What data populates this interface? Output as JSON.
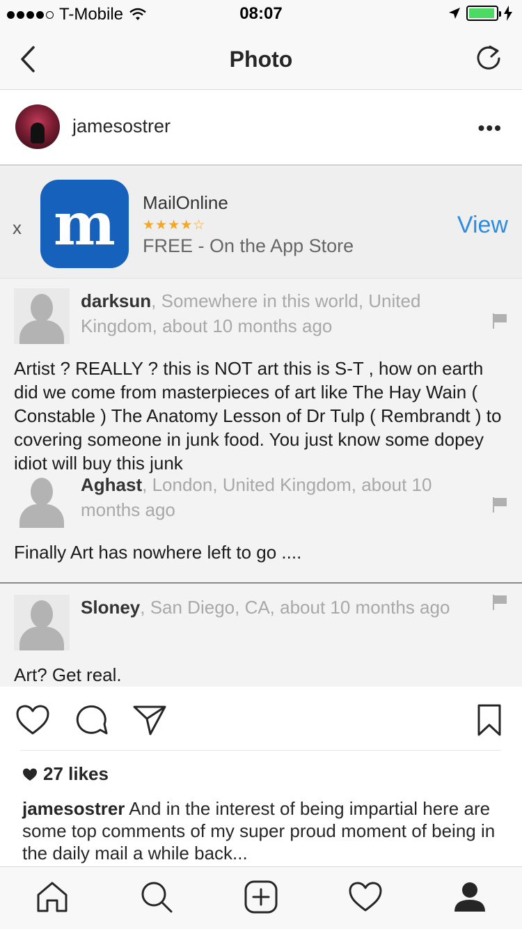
{
  "status_bar": {
    "carrier": "T-Mobile",
    "time": "08:07",
    "battery_level": 0.95
  },
  "nav": {
    "title": "Photo"
  },
  "post": {
    "username": "jamesostrer",
    "more_label": "•••"
  },
  "ad": {
    "close_label": "x",
    "icon_letter": "m",
    "title": "MailOnline",
    "rating_stars": "★★★★☆",
    "subtitle": "FREE - On the App Store",
    "view_label": "View"
  },
  "comments": [
    {
      "name": "darksun",
      "meta": ", Somewhere in this world, United Kingdom, about 10 months ago",
      "body": "Artist ? REALLY ? this is NOT art this is S-T , how on earth did we come from masterpieces of art like The Hay Wain ( Constable ) The Anatomy Lesson of Dr Tulp ( Rembrandt ) to covering someone in junk food. You just know some dopey idiot will buy this junk"
    },
    {
      "name": "Aghast",
      "meta": ", London, United Kingdom, about 10 months ago",
      "body": "Finally Art has nowhere left to go ...."
    },
    {
      "name": "Sloney",
      "meta": ", San Diego, CA, about 10 months ago",
      "body": "Art? Get real."
    }
  ],
  "likes": {
    "text": "27 likes"
  },
  "caption": {
    "username": "jamesostrer",
    "text": " And in the interest of being impartial here are some top comments of my super proud moment of being in the daily mail a while back..."
  },
  "icons": {
    "nav": [
      "back-icon",
      "refresh-icon"
    ],
    "actions": [
      "heart-icon",
      "comment-icon",
      "share-icon",
      "bookmark-icon"
    ],
    "tabs": [
      "home-icon",
      "search-icon",
      "add-icon",
      "activity-icon",
      "profile-icon"
    ]
  },
  "colors": {
    "link_blue": "#2d8ce0",
    "ad_icon_blue": "#1561bb",
    "star_orange": "#f5a623",
    "battery_green": "#4cd964"
  }
}
